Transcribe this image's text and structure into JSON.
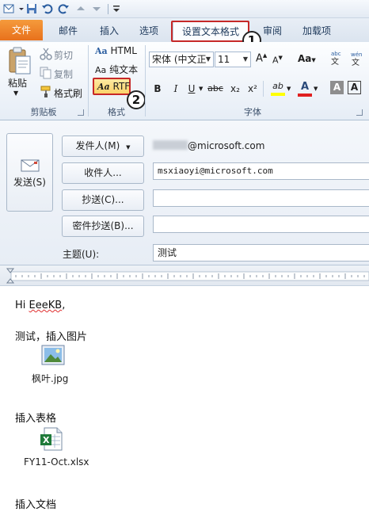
{
  "ribbon_tabs": {
    "file": "文件",
    "mail": "邮件",
    "insert": "插入",
    "options": "选项",
    "format_text": "设置文本格式",
    "review": "审阅",
    "addins": "加载项"
  },
  "callouts": {
    "one": "1",
    "two": "2"
  },
  "clipboard": {
    "paste": "粘贴",
    "cut": "剪切",
    "copy": "复制",
    "format_painter": "格式刷",
    "group_label": "剪贴板"
  },
  "format": {
    "html": "HTML",
    "plain_text": "纯文本",
    "rtf": "RTF",
    "aa_prefix": "Aa",
    "group_label": "格式"
  },
  "font": {
    "font_name": "宋体 (中文正",
    "font_size": "11",
    "group_label": "字体",
    "bold": "B",
    "italic": "I",
    "underline": "U",
    "strikethrough": "abc",
    "subscript": "x₂",
    "superscript": "x²",
    "grow": "A",
    "shrink": "A",
    "change_case": "Aa",
    "font_color_letter": "A",
    "clear_format": "A",
    "highlight_text": "ab"
  },
  "compose": {
    "send": "发送(S)",
    "from_button": "发件人(M)",
    "from_value": "@microsoft.com",
    "to_button": "收件人...",
    "to_value": "msxiaoyi@microsoft.com",
    "cc_button": "抄送(C)...",
    "bcc_button": "密件抄送(B)...",
    "subject_label": "主题(U):",
    "subject_value": "测试"
  },
  "message": {
    "greeting_prefix": "Hi ",
    "greeting_name": "EeeKB",
    "greeting_suffix": ",",
    "line_insert_image": "测试，插入图片",
    "image_filename": "枫叶.jpg",
    "line_insert_table": "插入表格",
    "table_filename": "FY11-Oct.xlsx",
    "line_insert_doc": "插入文档"
  },
  "colors": {
    "file_tab": "#e8711c",
    "highlight_box": "#c62828",
    "ribbon_bg": "#e6edf6",
    "rtf_selected": "#fbd36a"
  }
}
